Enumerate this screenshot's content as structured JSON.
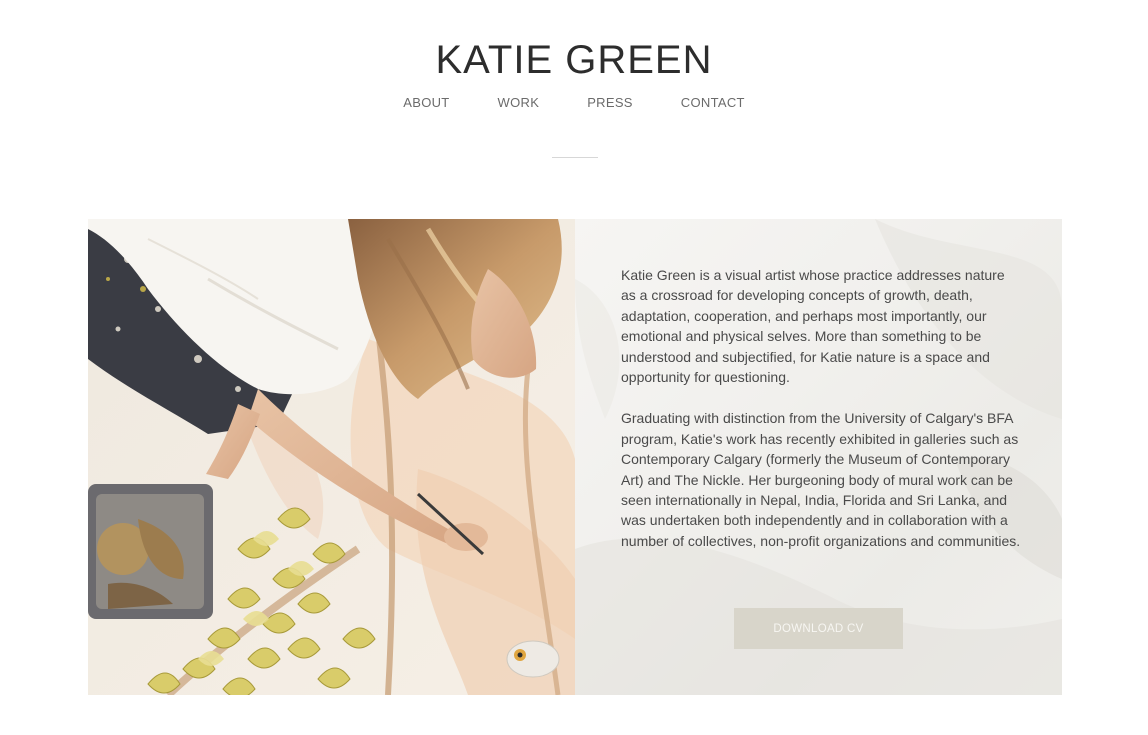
{
  "header": {
    "site_title": "KATIE GREEN"
  },
  "nav": {
    "items": [
      "ABOUT",
      "WORK",
      "PRESS",
      "CONTACT"
    ]
  },
  "about": {
    "photo_alt": "Katie Green painting a mural on the floor",
    "paragraphs": [
      "Katie Green is a visual artist whose practice addresses nature as a crossroad for developing concepts of growth, death, adaptation, cooperation, and perhaps most importantly, our emotional and physical selves. More than something to be understood and subjectified, for Katie nature is a space and opportunity for questioning.",
      "Graduating with distinction from the University of Calgary's BFA program, Katie's work has recently exhibited in galleries such as Contemporary Calgary (formerly the Museum of Contemporary Art) and The Nickle. Her burgeoning body of mural work can be seen internationally in Nepal, India, Florida and Sri Lanka, and was undertaken both independently and in collaboration with a number of collectives, non-profit organizations and communities."
    ],
    "cv_button_label": "DOWNLOAD CV"
  },
  "colors": {
    "title": "#2d2d2d",
    "nav": "#6b6b6b",
    "button_bg": "#d8d5ca",
    "button_text": "#f7f6f2"
  }
}
